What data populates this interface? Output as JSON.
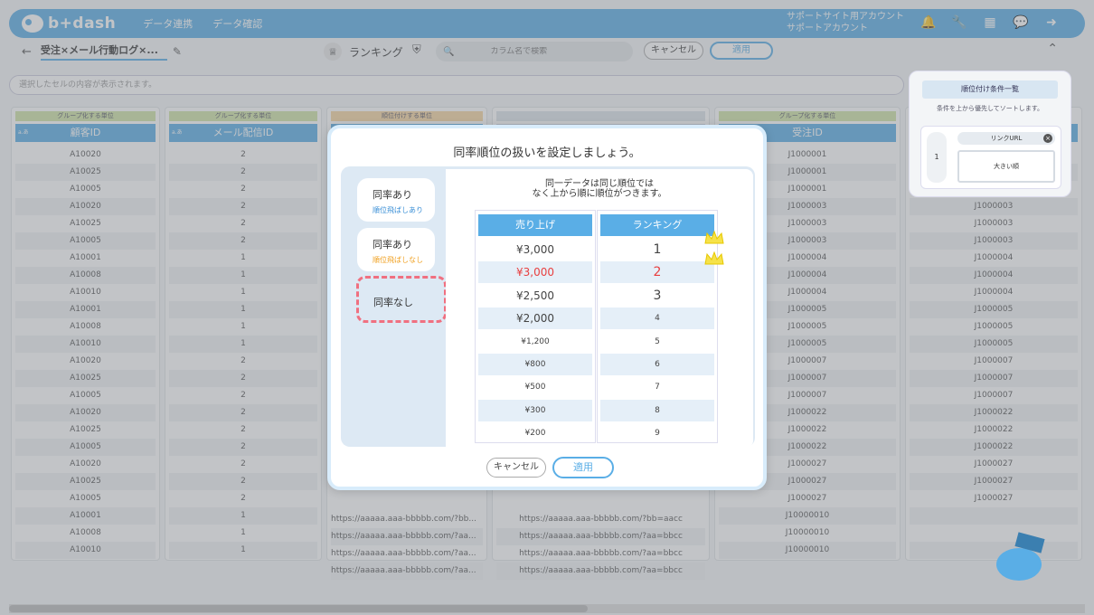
{
  "app": {
    "logo": "b+dash",
    "nav": [
      "データ連携",
      "データ確認"
    ],
    "support_line1": "サポートサイト用アカウント",
    "support_line2": "サポートアカウント",
    "nav_icons": [
      "bell-icon",
      "wrench-icon",
      "grid-icon",
      "chat-icon",
      "logout-icon"
    ]
  },
  "toolbar": {
    "view_name": "受注×メール行動ログ×...",
    "ranking_label": "ランキング",
    "search_placeholder": "カラム名で検索",
    "cancel_label": "キャンセル",
    "apply_label": "適用"
  },
  "cell_bar": {
    "placeholder": "選択したセルの内容が表示されます。"
  },
  "grid": {
    "columns": [
      {
        "caption": "グループ化する単位",
        "header": "顧客ID",
        "cells": [
          "A10020",
          "A10025",
          "A10005",
          "A10020",
          "A10025",
          "A10005",
          "A10001",
          "A10008",
          "A10010",
          "A10001",
          "A10008",
          "A10010",
          "A10020",
          "A10025",
          "A10005",
          "A10020",
          "A10025",
          "A10005",
          "A10020",
          "A10025",
          "A10005",
          "A10001",
          "A10008",
          "A10010"
        ]
      },
      {
        "caption": "グループ化する単位",
        "header": "メール配信ID",
        "cells": [
          "2",
          "2",
          "2",
          "2",
          "2",
          "2",
          "1",
          "1",
          "1",
          "1",
          "1",
          "1",
          "2",
          "2",
          "2",
          "2",
          "2",
          "2",
          "2",
          "2",
          "2",
          "1",
          "1",
          "1"
        ]
      },
      {
        "caption": "順位付けする単位",
        "header": "",
        "cells": [
          "https://aaaaa.aaa-bbbbb.com/?bb...",
          "https://aaaaa.aaa-bbbbb.com/?aa...",
          "https://aaaaa.aaa-bbbbb.com/?aa...",
          "https://aaaaa.aaa-bbbbb.com/?aa..."
        ]
      },
      {
        "caption": "",
        "header": "",
        "cells": [
          "https://aaaaa.aaa-bbbbb.com/?bb=aacc",
          "https://aaaaa.aaa-bbbbb.com/?aa=bbcc",
          "https://aaaaa.aaa-bbbbb.com/?aa=bbcc",
          "https://aaaaa.aaa-bbbbb.com/?aa=bbcc"
        ]
      },
      {
        "caption": "グループ化する単位",
        "header": "受注ID",
        "cells": [
          "J1000001",
          "J1000001",
          "J1000001",
          "J1000003",
          "J1000003",
          "J1000003",
          "J1000004",
          "J1000004",
          "J1000004",
          "J1000005",
          "J1000005",
          "J1000005",
          "J1000007",
          "J1000007",
          "J1000007",
          "J1000022",
          "J1000022",
          "J1000022",
          "J1000027",
          "J1000027",
          "J1000027",
          "J10000010",
          "J10000010",
          "J10000010"
        ]
      },
      {
        "caption": "",
        "header": "",
        "cells": [
          "",
          "",
          "",
          "J1000003",
          "J1000003",
          "J1000003",
          "J1000004",
          "J1000004",
          "J1000004",
          "J1000005",
          "J1000005",
          "J1000005",
          "J1000007",
          "J1000007",
          "J1000007",
          "J1000022",
          "J1000022",
          "J1000022",
          "J1000027",
          "J1000027",
          "J1000027",
          "",
          "",
          ""
        ]
      }
    ]
  },
  "rank_panel": {
    "title": "順位付け条件一覧",
    "subtitle": "条件を上から優先してソートします。",
    "item_number": "1",
    "item_chip": "リンクURL",
    "item_order": "大きい順"
  },
  "modal": {
    "title": "同率順位の扱いを設定しましょう。",
    "options": [
      {
        "label": "同率あり",
        "sub": "順位飛ばしあり",
        "sub_color": "#3a8fd6"
      },
      {
        "label": "同率あり",
        "sub": "順位飛ばしなし",
        "sub_color": "#f0a020"
      },
      {
        "label": "同率なし",
        "sub": ""
      }
    ],
    "desc_line1": "同一データは同じ順位では",
    "desc_line2": "なく上から順に順位がつきます。",
    "table": {
      "col1_header": "売り上げ",
      "col2_header": "ランキング",
      "sales": [
        "¥3,000",
        "¥3,000",
        "¥2,500",
        "¥2,000",
        "¥1,200",
        "¥800",
        "¥500",
        "¥300",
        "¥200"
      ],
      "ranks": [
        "1",
        "2",
        "3",
        "4",
        "5",
        "6",
        "7",
        "8",
        "9"
      ]
    },
    "cancel_label": "キャンセル",
    "apply_label": "適用"
  }
}
